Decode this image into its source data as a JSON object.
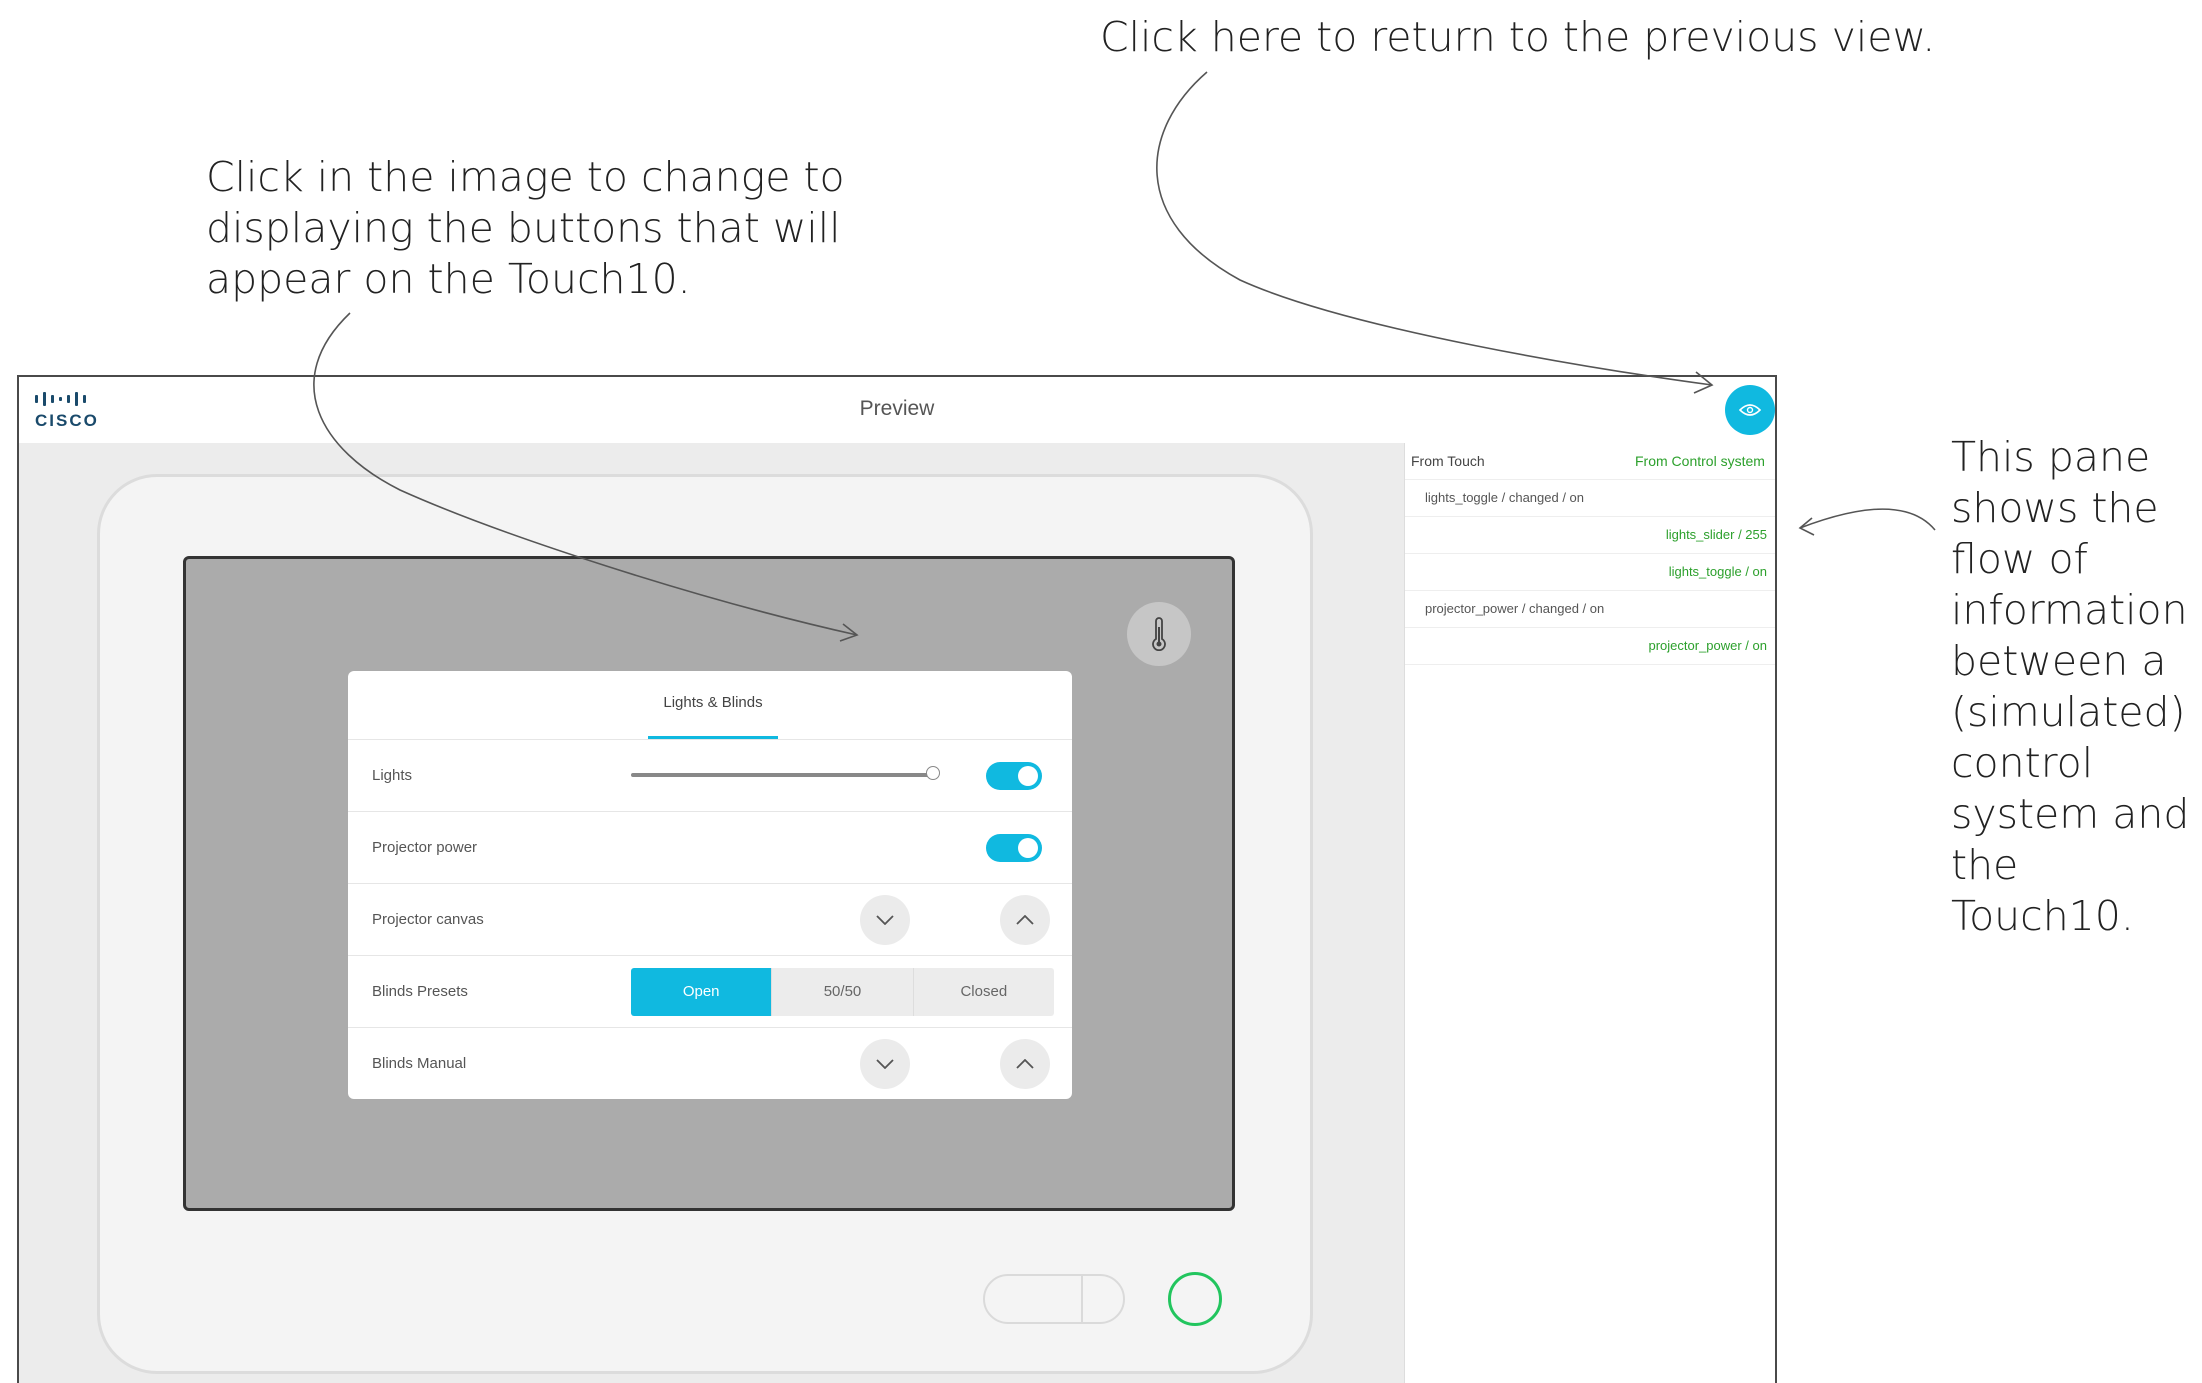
{
  "annotations": {
    "return_view": "Click here to return to the previous view.",
    "image_click": [
      "Click in the image to change to",
      "displaying the buttons that will",
      "appear on the Touch10."
    ],
    "pane_info": [
      "This pane",
      "shows the",
      "flow of",
      "information",
      "between a",
      "(simulated)",
      "control",
      "system and",
      "the Touch10."
    ]
  },
  "app": {
    "logo_text": "CISCO",
    "title": "Preview",
    "eye_icon": "eye-icon",
    "accent_color": "#10b9e0"
  },
  "panel": {
    "tab_label": "Lights & Blinds",
    "rows": [
      {
        "label": "Lights",
        "control": "slider+toggle",
        "slider_value": 1.0,
        "toggle": "on"
      },
      {
        "label": "Projector power",
        "control": "toggle",
        "toggle": "on"
      },
      {
        "label": "Projector canvas",
        "control": "down-up"
      },
      {
        "label": "Blinds Presets",
        "control": "segmented",
        "options": [
          "Open",
          "50/50",
          "Closed"
        ],
        "selected": "Open"
      },
      {
        "label": "Blinds Manual",
        "control": "down-up"
      }
    ]
  },
  "log": {
    "from_touch_label": "From Touch",
    "from_control_label": "From Control system",
    "entries": [
      {
        "source": "touch",
        "text": "lights_toggle / changed / on"
      },
      {
        "source": "control",
        "text": "lights_slider / 255"
      },
      {
        "source": "control",
        "text": "lights_toggle / on"
      },
      {
        "source": "touch",
        "text": "projector_power / changed / on"
      },
      {
        "source": "control",
        "text": "projector_power / on"
      }
    ],
    "control_color": "#2ca02c"
  }
}
